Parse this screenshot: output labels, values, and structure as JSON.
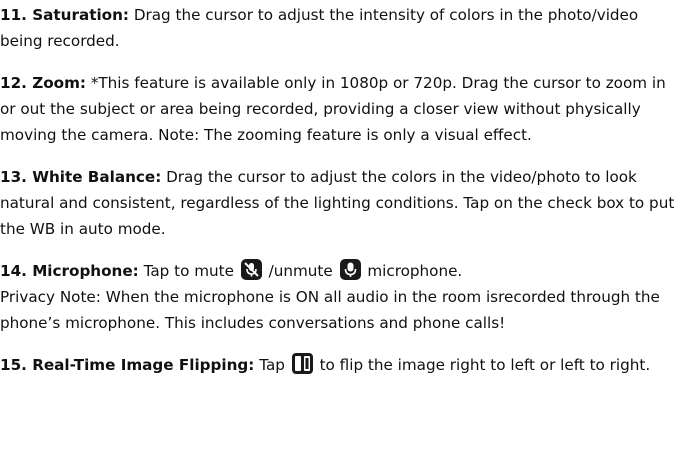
{
  "items": [
    {
      "title": "11. Saturation:",
      "text": "Drag the cursor to adjust the intensity of colors in the photo/video being recorded."
    },
    {
      "title": "12. Zoom:",
      "text": "*This feature is available only in 1080p or 720p. Drag the cursor to zoom in or out the subject or area being recorded, providing a closer view without physically moving the camera. Note: The zooming feature is only a visual effect."
    },
    {
      "title": "13. White Balance:",
      "text": "Drag the cursor to adjust the colors in the video/photo to look natural and consistent, regardless of the lighting conditions. Tap on the check box to put the WB in auto mode."
    },
    {
      "title": "14. Microphone:",
      "text_a": "Tap to mute",
      "text_b": "/unmute",
      "text_c": "microphone.",
      "privacy": "Privacy Note: When the microphone is ON all audio in the room isrecorded through the phone’s microphone. This includes conversations and phone calls!"
    },
    {
      "title": "15. Real-Time Image Flipping:",
      "text_a": "Tap",
      "text_b": "to flip the image right to left or left to right."
    }
  ],
  "icons": {
    "mute": "mic-muted-icon",
    "unmute": "mic-icon",
    "flip": "flip-image-icon"
  }
}
